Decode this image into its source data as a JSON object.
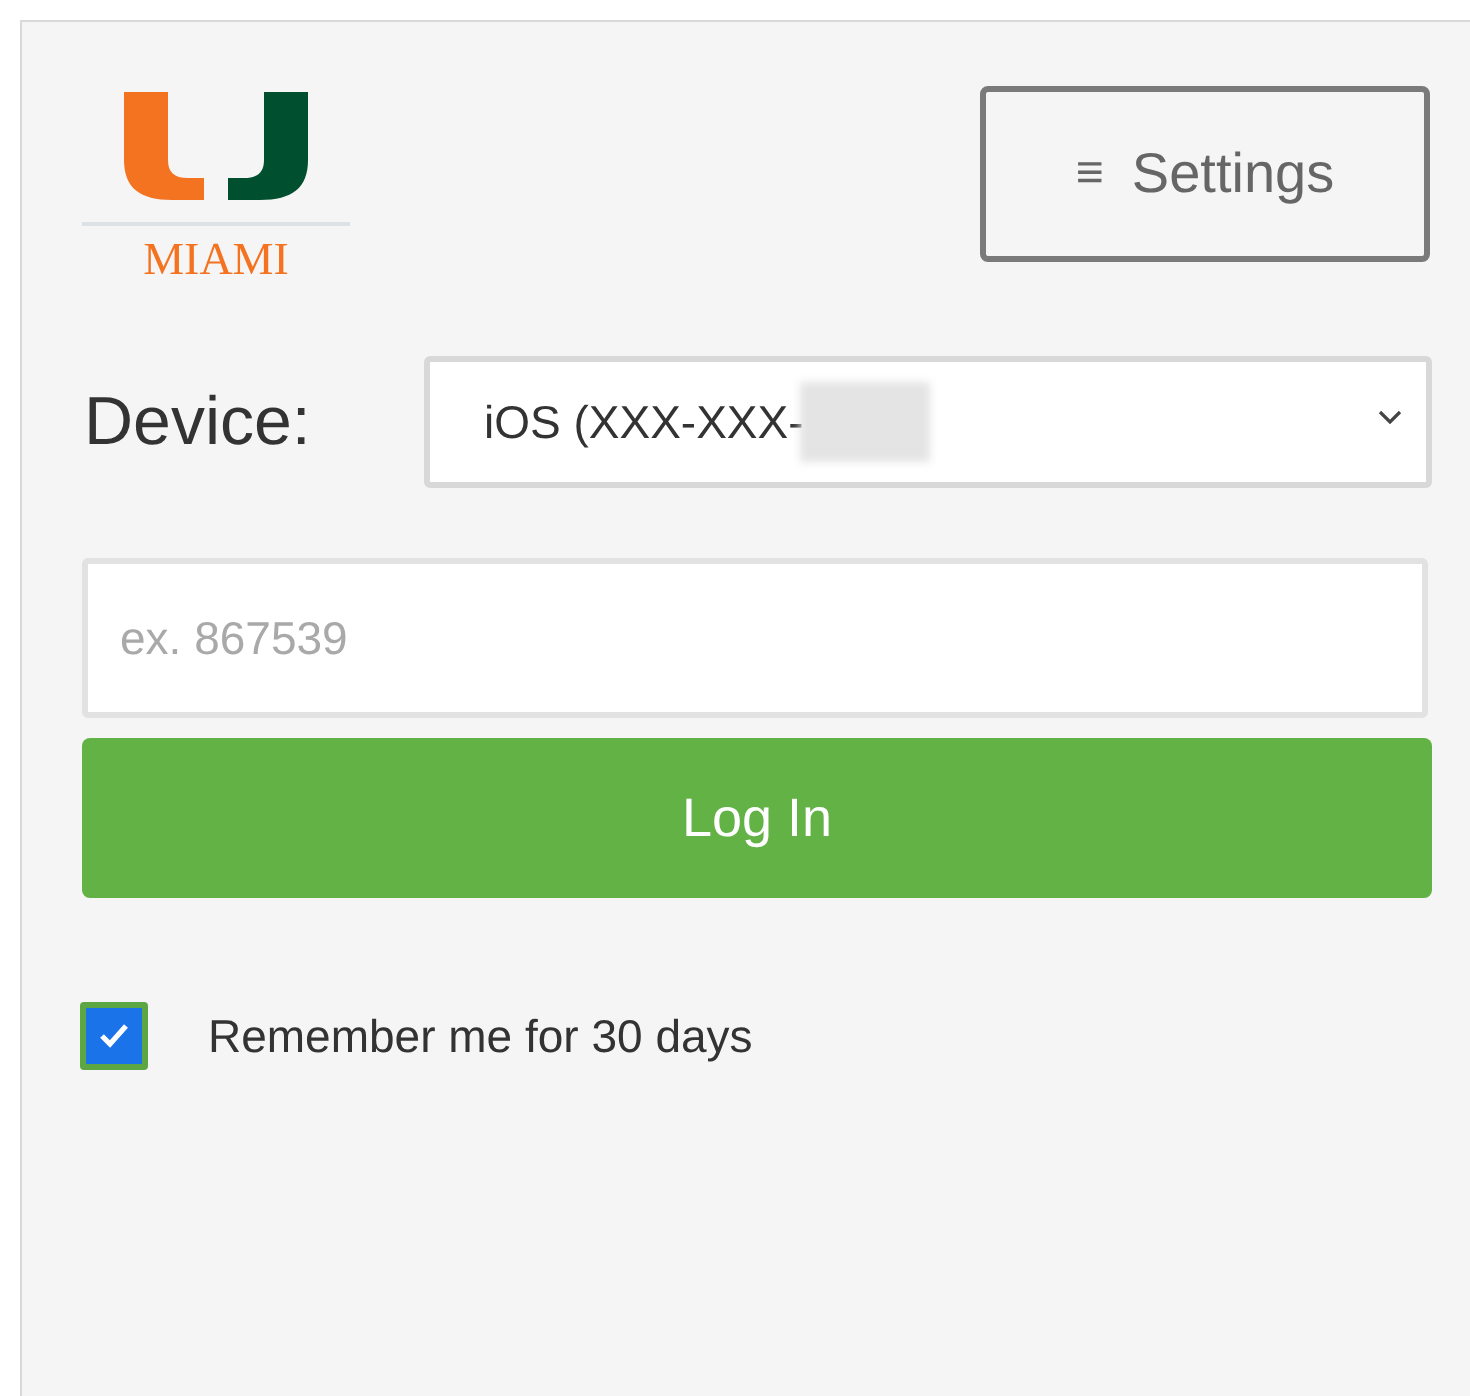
{
  "logo": {
    "wordmark": "MIAMI"
  },
  "settings_button": {
    "icon": "≡",
    "label": "Settings"
  },
  "device": {
    "label": "Device:",
    "value": "iOS (XXX-XXX-",
    "redacted": true
  },
  "code_field": {
    "placeholder": "ex. 867539"
  },
  "login_button": {
    "label": "Log In"
  },
  "remember": {
    "label": "Remember me for 30 days",
    "checked": true
  }
}
